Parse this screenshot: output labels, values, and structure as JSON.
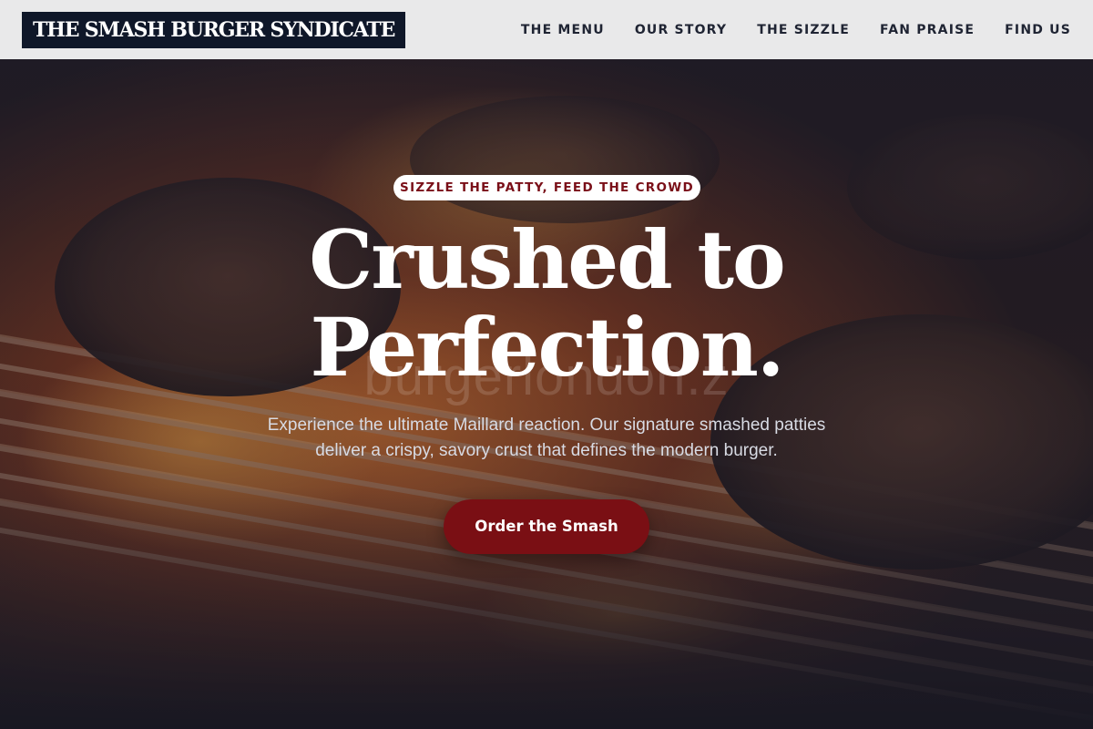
{
  "header": {
    "logo_text": "THE SMASH BURGER SYNDICATE",
    "nav": [
      {
        "label": "THE MENU"
      },
      {
        "label": "OUR STORY"
      },
      {
        "label": "THE SIZZLE"
      },
      {
        "label": "FAN PRAISE"
      },
      {
        "label": "FIND US"
      }
    ]
  },
  "hero": {
    "tagline": "SIZZLE THE PATTY, FEED THE CROWD",
    "headline_line1": "Crushed to",
    "headline_line2": "Perfection.",
    "watermark": "burgerlondon.z",
    "subtext": "Experience the ultimate Maillard reaction. Our signature smashed patties deliver a crispy, savory crust that defines the modern burger.",
    "cta_label": "Order the Smash"
  },
  "colors": {
    "header_bg": "#e9e9ea",
    "logo_bg": "#0f1729",
    "accent": "#7a0f14",
    "overlay": "#161a2c"
  }
}
